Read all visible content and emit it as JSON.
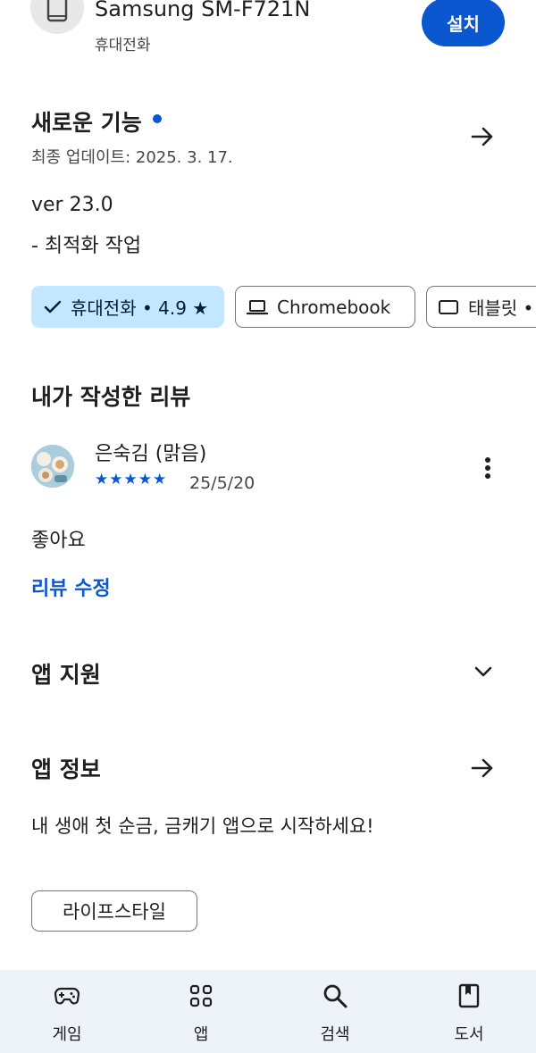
{
  "device": {
    "name": "Samsung SM-F721N",
    "type": "휴대전화",
    "install_label": "설치"
  },
  "whats_new": {
    "title": "새로운 기능",
    "updated": "최종 업데이트: 2025. 3. 17.",
    "version": "ver 23.0",
    "note": "- 최적화 작업"
  },
  "device_chips": [
    {
      "label": "휴대전화 • 4.9 ★",
      "selected": true
    },
    {
      "label": "Chromebook",
      "selected": false
    },
    {
      "label": "태블릿 •",
      "selected": false
    }
  ],
  "my_review": {
    "title": "내가 작성한 리뷰",
    "reviewer": "은숙김 (맑음)",
    "stars": "★★★★★",
    "rating": 5,
    "date": "25/5/20",
    "text": "좋아요",
    "edit_label": "리뷰 수정"
  },
  "app_support": {
    "title": "앱 지원"
  },
  "app_info": {
    "title": "앱 정보",
    "description": "내 생애 첫 순금, 금캐기 앱으로 시작하세요!",
    "category": "라이프스타일"
  },
  "bottom_nav": [
    {
      "label": "게임",
      "icon": "gamepad-icon"
    },
    {
      "label": "앱",
      "icon": "apps-grid-icon"
    },
    {
      "label": "검색",
      "icon": "search-icon"
    },
    {
      "label": "도서",
      "icon": "book-icon"
    }
  ],
  "colors": {
    "accent": "#0b57d0",
    "chip_selected": "#c2e7ff",
    "nav_bg": "#eef2f9"
  }
}
